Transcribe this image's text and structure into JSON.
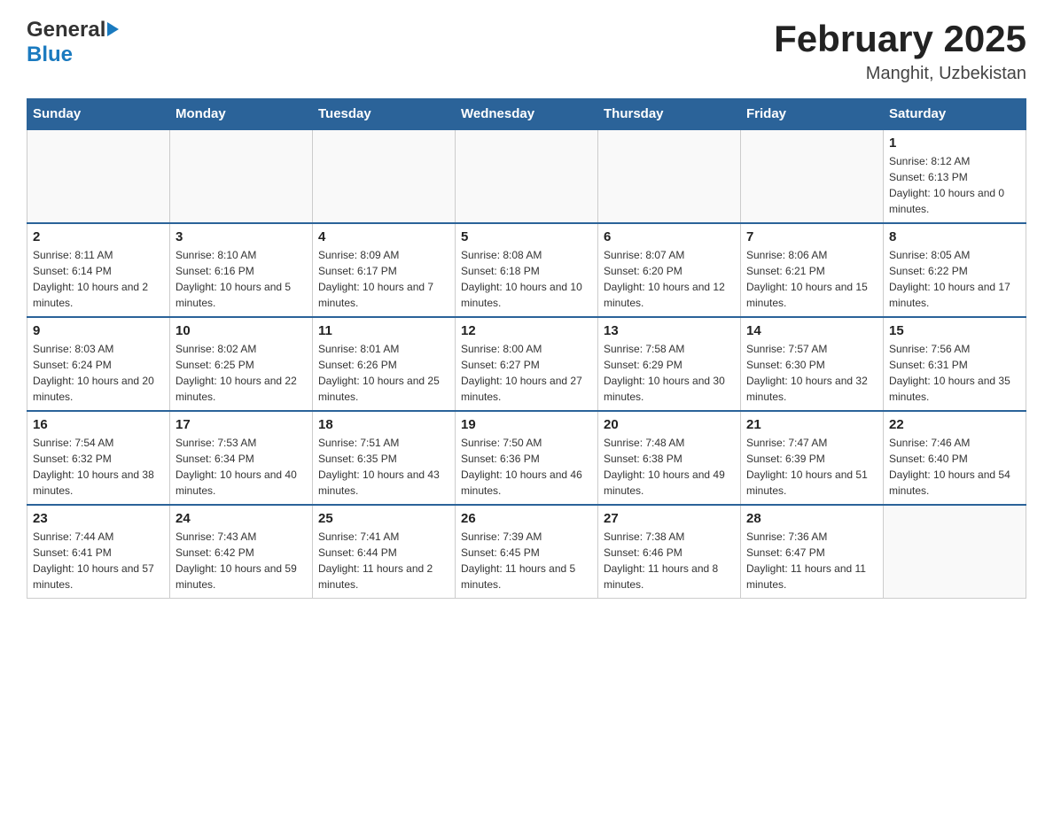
{
  "header": {
    "logo_general": "General",
    "logo_blue": "Blue",
    "month_title": "February 2025",
    "location": "Manghit, Uzbekistan"
  },
  "weekdays": [
    "Sunday",
    "Monday",
    "Tuesday",
    "Wednesday",
    "Thursday",
    "Friday",
    "Saturday"
  ],
  "weeks": [
    [
      {
        "day": "",
        "info": ""
      },
      {
        "day": "",
        "info": ""
      },
      {
        "day": "",
        "info": ""
      },
      {
        "day": "",
        "info": ""
      },
      {
        "day": "",
        "info": ""
      },
      {
        "day": "",
        "info": ""
      },
      {
        "day": "1",
        "info": "Sunrise: 8:12 AM\nSunset: 6:13 PM\nDaylight: 10 hours and 0 minutes."
      }
    ],
    [
      {
        "day": "2",
        "info": "Sunrise: 8:11 AM\nSunset: 6:14 PM\nDaylight: 10 hours and 2 minutes."
      },
      {
        "day": "3",
        "info": "Sunrise: 8:10 AM\nSunset: 6:16 PM\nDaylight: 10 hours and 5 minutes."
      },
      {
        "day": "4",
        "info": "Sunrise: 8:09 AM\nSunset: 6:17 PM\nDaylight: 10 hours and 7 minutes."
      },
      {
        "day": "5",
        "info": "Sunrise: 8:08 AM\nSunset: 6:18 PM\nDaylight: 10 hours and 10 minutes."
      },
      {
        "day": "6",
        "info": "Sunrise: 8:07 AM\nSunset: 6:20 PM\nDaylight: 10 hours and 12 minutes."
      },
      {
        "day": "7",
        "info": "Sunrise: 8:06 AM\nSunset: 6:21 PM\nDaylight: 10 hours and 15 minutes."
      },
      {
        "day": "8",
        "info": "Sunrise: 8:05 AM\nSunset: 6:22 PM\nDaylight: 10 hours and 17 minutes."
      }
    ],
    [
      {
        "day": "9",
        "info": "Sunrise: 8:03 AM\nSunset: 6:24 PM\nDaylight: 10 hours and 20 minutes."
      },
      {
        "day": "10",
        "info": "Sunrise: 8:02 AM\nSunset: 6:25 PM\nDaylight: 10 hours and 22 minutes."
      },
      {
        "day": "11",
        "info": "Sunrise: 8:01 AM\nSunset: 6:26 PM\nDaylight: 10 hours and 25 minutes."
      },
      {
        "day": "12",
        "info": "Sunrise: 8:00 AM\nSunset: 6:27 PM\nDaylight: 10 hours and 27 minutes."
      },
      {
        "day": "13",
        "info": "Sunrise: 7:58 AM\nSunset: 6:29 PM\nDaylight: 10 hours and 30 minutes."
      },
      {
        "day": "14",
        "info": "Sunrise: 7:57 AM\nSunset: 6:30 PM\nDaylight: 10 hours and 32 minutes."
      },
      {
        "day": "15",
        "info": "Sunrise: 7:56 AM\nSunset: 6:31 PM\nDaylight: 10 hours and 35 minutes."
      }
    ],
    [
      {
        "day": "16",
        "info": "Sunrise: 7:54 AM\nSunset: 6:32 PM\nDaylight: 10 hours and 38 minutes."
      },
      {
        "day": "17",
        "info": "Sunrise: 7:53 AM\nSunset: 6:34 PM\nDaylight: 10 hours and 40 minutes."
      },
      {
        "day": "18",
        "info": "Sunrise: 7:51 AM\nSunset: 6:35 PM\nDaylight: 10 hours and 43 minutes."
      },
      {
        "day": "19",
        "info": "Sunrise: 7:50 AM\nSunset: 6:36 PM\nDaylight: 10 hours and 46 minutes."
      },
      {
        "day": "20",
        "info": "Sunrise: 7:48 AM\nSunset: 6:38 PM\nDaylight: 10 hours and 49 minutes."
      },
      {
        "day": "21",
        "info": "Sunrise: 7:47 AM\nSunset: 6:39 PM\nDaylight: 10 hours and 51 minutes."
      },
      {
        "day": "22",
        "info": "Sunrise: 7:46 AM\nSunset: 6:40 PM\nDaylight: 10 hours and 54 minutes."
      }
    ],
    [
      {
        "day": "23",
        "info": "Sunrise: 7:44 AM\nSunset: 6:41 PM\nDaylight: 10 hours and 57 minutes."
      },
      {
        "day": "24",
        "info": "Sunrise: 7:43 AM\nSunset: 6:42 PM\nDaylight: 10 hours and 59 minutes."
      },
      {
        "day": "25",
        "info": "Sunrise: 7:41 AM\nSunset: 6:44 PM\nDaylight: 11 hours and 2 minutes."
      },
      {
        "day": "26",
        "info": "Sunrise: 7:39 AM\nSunset: 6:45 PM\nDaylight: 11 hours and 5 minutes."
      },
      {
        "day": "27",
        "info": "Sunrise: 7:38 AM\nSunset: 6:46 PM\nDaylight: 11 hours and 8 minutes."
      },
      {
        "day": "28",
        "info": "Sunrise: 7:36 AM\nSunset: 6:47 PM\nDaylight: 11 hours and 11 minutes."
      },
      {
        "day": "",
        "info": ""
      }
    ]
  ]
}
